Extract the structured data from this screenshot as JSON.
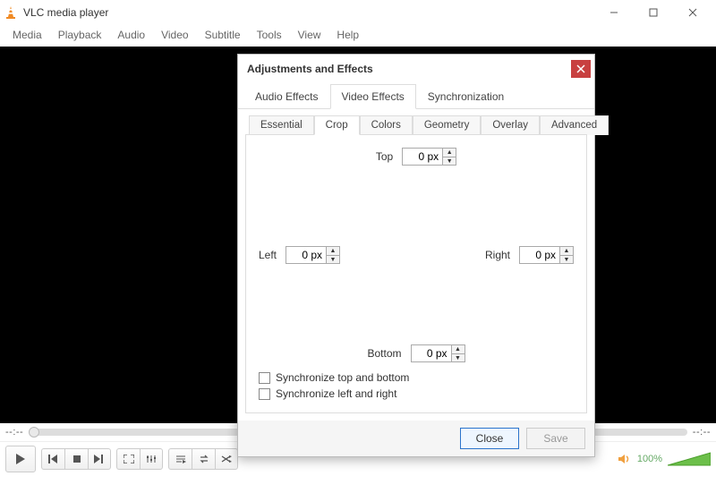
{
  "window": {
    "title": "VLC media player"
  },
  "menubar": [
    "Media",
    "Playback",
    "Audio",
    "Video",
    "Subtitle",
    "Tools",
    "View",
    "Help"
  ],
  "seek": {
    "elapsed": "--:--",
    "total": "--:--"
  },
  "volume": {
    "percent_label": "100%"
  },
  "dialog": {
    "title": "Adjustments and Effects",
    "tabs_main": {
      "audio": "Audio Effects",
      "video": "Video Effects",
      "sync": "Synchronization"
    },
    "tabs_sub": {
      "essential": "Essential",
      "crop": "Crop",
      "colors": "Colors",
      "geometry": "Geometry",
      "overlay": "Overlay",
      "advanced": "Advanced"
    },
    "crop": {
      "top_label": "Top",
      "top_value": "0 px",
      "left_label": "Left",
      "left_value": "0 px",
      "right_label": "Right",
      "right_value": "0 px",
      "bottom_label": "Bottom",
      "bottom_value": "0 px",
      "sync_tb": "Synchronize top and bottom",
      "sync_lr": "Synchronize left and right"
    },
    "buttons": {
      "close": "Close",
      "save": "Save"
    }
  }
}
